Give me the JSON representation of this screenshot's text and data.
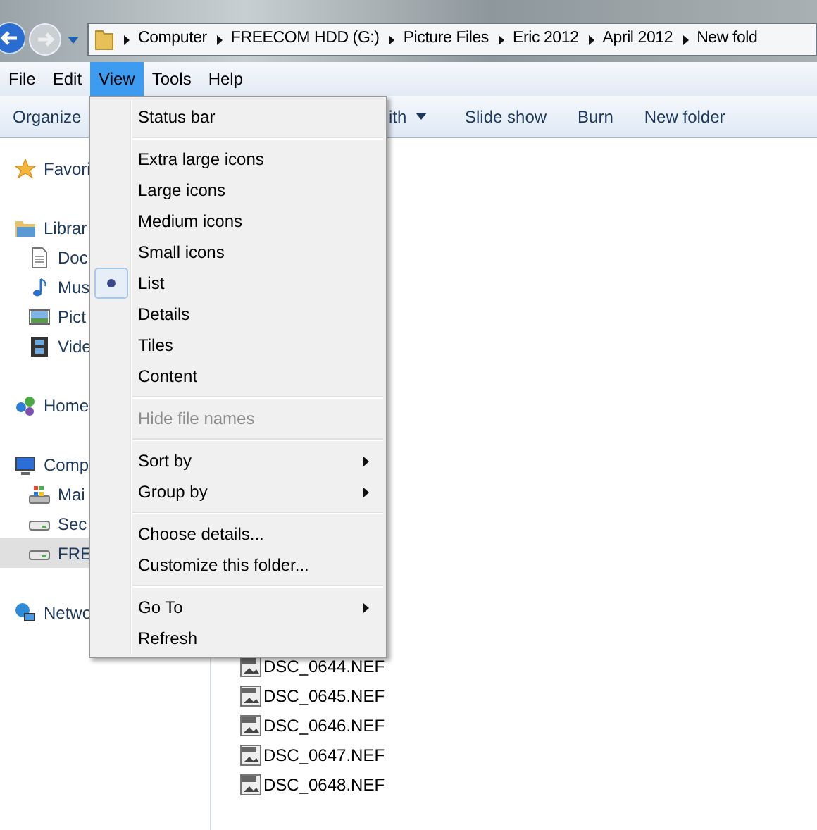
{
  "address_bar": {
    "crumbs": [
      "Computer",
      "FREECOM HDD (G:)",
      "Picture Files",
      "Eric 2012",
      "April 2012",
      "New fold"
    ]
  },
  "menu_bar": [
    {
      "label": "File",
      "selected": false
    },
    {
      "label": "Edit",
      "selected": false
    },
    {
      "label": "View",
      "selected": true
    },
    {
      "label": "Tools",
      "selected": false
    },
    {
      "label": "Help",
      "selected": false
    }
  ],
  "toolbar": [
    {
      "label": "Organize"
    },
    {
      "label": "ith",
      "dropdown": true
    },
    {
      "label": "Slide show",
      "dropdown": false
    },
    {
      "label": "Burn",
      "dropdown": false
    },
    {
      "label": "New folder",
      "dropdown": false
    }
  ],
  "sidebar": {
    "sections": [
      {
        "label": "Favori",
        "kind": "star",
        "selected": false
      },
      {
        "label": "Librar",
        "kind": "library",
        "selected": false,
        "children": [
          {
            "label": "Doc",
            "kind": "document",
            "selected": false
          },
          {
            "label": "Mus",
            "kind": "music",
            "selected": false
          },
          {
            "label": "Pict",
            "kind": "picture",
            "selected": false
          },
          {
            "label": "Vide",
            "kind": "video",
            "selected": false
          }
        ]
      },
      {
        "label": "Home",
        "kind": "homegroup",
        "selected": false
      },
      {
        "label": "Comp",
        "kind": "computer",
        "selected": false,
        "children": [
          {
            "label": "Mai",
            "kind": "system-drive",
            "selected": false
          },
          {
            "label": "Sec",
            "kind": "drive",
            "selected": false
          },
          {
            "label": "FRE",
            "kind": "drive",
            "selected": true
          }
        ]
      },
      {
        "label": "Netwo",
        "kind": "network",
        "selected": false
      }
    ]
  },
  "view_menu": {
    "items": [
      {
        "kind": "item",
        "label": "Status bar",
        "checked": false,
        "disabled": false,
        "submenu": false
      },
      {
        "kind": "separator"
      },
      {
        "kind": "item",
        "label": "Extra large icons",
        "checked": false,
        "disabled": false,
        "submenu": false
      },
      {
        "kind": "item",
        "label": "Large icons",
        "checked": false,
        "disabled": false,
        "submenu": false
      },
      {
        "kind": "item",
        "label": "Medium icons",
        "checked": false,
        "disabled": false,
        "submenu": false
      },
      {
        "kind": "item",
        "label": "Small icons",
        "checked": false,
        "disabled": false,
        "submenu": false
      },
      {
        "kind": "item",
        "label": "List",
        "checked": true,
        "disabled": false,
        "submenu": false
      },
      {
        "kind": "item",
        "label": "Details",
        "checked": false,
        "disabled": false,
        "submenu": false
      },
      {
        "kind": "item",
        "label": "Tiles",
        "checked": false,
        "disabled": false,
        "submenu": false
      },
      {
        "kind": "item",
        "label": "Content",
        "checked": false,
        "disabled": false,
        "submenu": false
      },
      {
        "kind": "separator"
      },
      {
        "kind": "item",
        "label": "Hide file names",
        "checked": false,
        "disabled": true,
        "submenu": false
      },
      {
        "kind": "separator"
      },
      {
        "kind": "item",
        "label": "Sort by",
        "checked": false,
        "disabled": false,
        "submenu": true
      },
      {
        "kind": "item",
        "label": "Group by",
        "checked": false,
        "disabled": false,
        "submenu": true
      },
      {
        "kind": "separator"
      },
      {
        "kind": "item",
        "label": "Choose details...",
        "checked": false,
        "disabled": false,
        "submenu": false
      },
      {
        "kind": "item",
        "label": "Customize this folder...",
        "checked": false,
        "disabled": false,
        "submenu": false
      },
      {
        "kind": "separator"
      },
      {
        "kind": "item",
        "label": "Go To",
        "checked": false,
        "disabled": false,
        "submenu": true
      },
      {
        "kind": "item",
        "label": "Refresh",
        "checked": false,
        "disabled": false,
        "submenu": false
      }
    ]
  },
  "files": [
    "DSC_0644.NEF",
    "DSC_0645.NEF",
    "DSC_0646.NEF",
    "DSC_0647.NEF",
    "DSC_0648.NEF"
  ]
}
